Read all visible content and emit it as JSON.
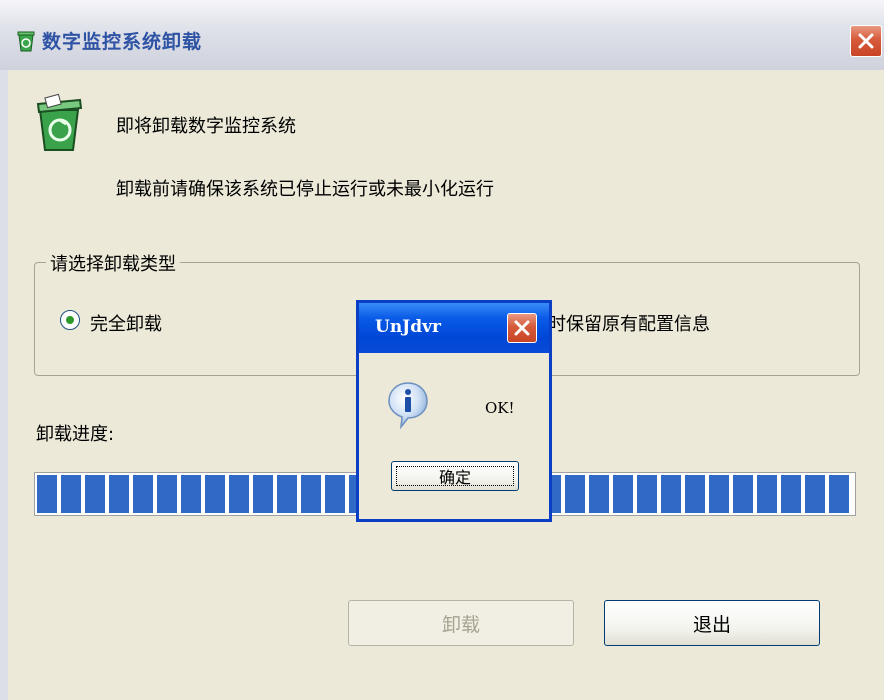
{
  "window": {
    "title": "数字监控系统卸载",
    "icon": "recycle-bin-icon",
    "close_icon": "close-icon"
  },
  "header": {
    "heading": "即将卸载数字监控系统",
    "subheading": "卸载前请确保该系统已停止运行或未最小化运行",
    "icon": "recycle-bin-icon"
  },
  "uninstall_type": {
    "legend": "请选择卸载类型",
    "option_full_label": "完全卸载",
    "option_full_selected": true,
    "option_partial_label_visible": "时保留原有配置信息"
  },
  "progress": {
    "label": "卸载进度:",
    "value_percent": 100
  },
  "buttons": {
    "uninstall_label": "卸载",
    "exit_label": "退出"
  },
  "messagebox": {
    "title": "UnJdvr",
    "message": "OK!",
    "ok_label": "确定",
    "icon": "info-icon"
  },
  "colors": {
    "accent_title": "#2f53a4",
    "progress_fill": "#3169c6",
    "dialog_titlebar": "#0a4ad8"
  }
}
